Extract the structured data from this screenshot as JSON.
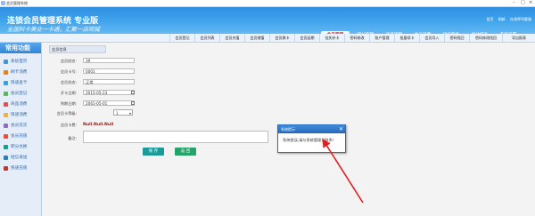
{
  "window": {
    "title": "会员管理系统"
  },
  "header": {
    "title": "连锁会员管理系统 专业版",
    "slogan": "全国科卡美业一卡通，汇聚一店同城",
    "links": [
      "首页",
      "刷新",
      "在线呼叫客服"
    ]
  },
  "main_nav": {
    "tabs": [
      {
        "label": "会员管理",
        "active": true
      },
      {
        "label": "积分管理"
      },
      {
        "label": "商品管理"
      },
      {
        "label": "会员消费"
      },
      {
        "label": "短信服务"
      },
      {
        "label": "统计报表"
      },
      {
        "label": "系统设置"
      }
    ]
  },
  "sub_nav": {
    "items": [
      "会员登记",
      "会员列表",
      "会员充值",
      "会员储值",
      "会员换卡",
      "会员延期",
      "挂失补卡",
      "密码修改",
      "账户管理",
      "批量续卡",
      "会员导入",
      "密码找回",
      "密码修改找回",
      "导出报表"
    ]
  },
  "sidebar": {
    "title": "常用功能",
    "items": [
      "系统首页",
      "刷卡消费",
      "快速查卡",
      "会员登记",
      "商品消费",
      "快速消费",
      "会员充次",
      "会员充值",
      "积分兑换",
      "短信发送",
      "快速充值"
    ]
  },
  "form": {
    "panel_title": "会员信息",
    "rows": [
      {
        "label": "会员姓名:",
        "value": "39"
      },
      {
        "label": "会员卡号:",
        "value": "0001"
      },
      {
        "label": "会员状态:",
        "value": "正常"
      },
      {
        "label": "开卡日期:",
        "value": "2015-05-23"
      },
      {
        "label": "到期日期:",
        "value": "2061-05-01"
      }
    ],
    "card_level_label": "会员卡等级:",
    "card_level_value": "1",
    "membership_fee_label": "会员卡费:",
    "membership_fee_value": "Null.Null.Null",
    "remark_label": "备注:",
    "save_label": "保 存",
    "back_label": "返 回"
  },
  "dialog": {
    "title": "系统提示",
    "message": "系统错误,请与系统管理员联系！",
    "close_glyph": "✕"
  },
  "colors": {
    "header_blue": "#3da1ec",
    "annotation_arrow": "#e02020",
    "button_teal": "#1c9a9a",
    "button_green": "#27a36a"
  }
}
